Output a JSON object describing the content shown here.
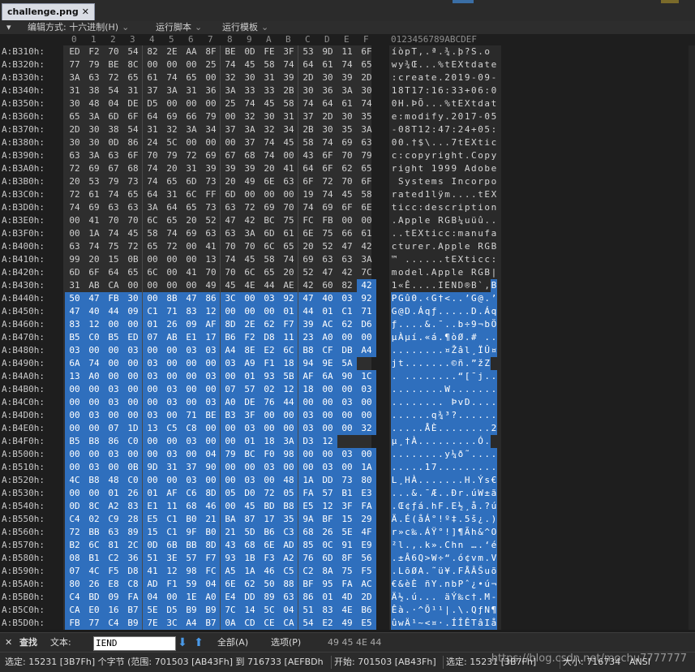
{
  "tab": {
    "title": "challenge.png",
    "close": "✕"
  },
  "toolbar": {
    "menu_glyph": "▾",
    "edit_mode": "编辑方式: 十六进制(H)",
    "run_script": "运行脚本",
    "run_template": "运行模板",
    "chevron": "⌄"
  },
  "hex_columns": [
    "0",
    "1",
    "2",
    "3",
    "4",
    "5",
    "6",
    "7",
    "8",
    "9",
    "A",
    "B",
    "C",
    "D",
    "E",
    "F"
  ],
  "ascii_header": "0123456789ABCDEF",
  "rows": [
    {
      "addr": "A:B310h:",
      "hex": [
        "ED",
        "F2",
        "70",
        "54",
        "82",
        "2E",
        "AA",
        "8F",
        "BE",
        "0D",
        "FE",
        "3F",
        "53",
        "9D",
        "11",
        "6F"
      ],
      "asc": "íòpT‚.ª.¾.þ?S.o"
    },
    {
      "addr": "A:B320h:",
      "hex": [
        "77",
        "79",
        "BE",
        "8C",
        "00",
        "00",
        "00",
        "25",
        "74",
        "45",
        "58",
        "74",
        "64",
        "61",
        "74",
        "65"
      ],
      "asc": "wy¾Œ...%tEXtdate"
    },
    {
      "addr": "A:B330h:",
      "hex": [
        "3A",
        "63",
        "72",
        "65",
        "61",
        "74",
        "65",
        "00",
        "32",
        "30",
        "31",
        "39",
        "2D",
        "30",
        "39",
        "2D"
      ],
      "asc": ":create.2019-09-"
    },
    {
      "addr": "A:B340h:",
      "hex": [
        "31",
        "38",
        "54",
        "31",
        "37",
        "3A",
        "31",
        "36",
        "3A",
        "33",
        "33",
        "2B",
        "30",
        "36",
        "3A",
        "30"
      ],
      "asc": "18T17:16:33+06:0"
    },
    {
      "addr": "A:B350h:",
      "hex": [
        "30",
        "48",
        "04",
        "DE",
        "D5",
        "00",
        "00",
        "00",
        "25",
        "74",
        "45",
        "58",
        "74",
        "64",
        "61",
        "74"
      ],
      "asc": "0H.ÞÕ...%tEXtdat"
    },
    {
      "addr": "A:B360h:",
      "hex": [
        "65",
        "3A",
        "6D",
        "6F",
        "64",
        "69",
        "66",
        "79",
        "00",
        "32",
        "30",
        "31",
        "37",
        "2D",
        "30",
        "35"
      ],
      "asc": "e:modify.2017-05"
    },
    {
      "addr": "A:B370h:",
      "hex": [
        "2D",
        "30",
        "38",
        "54",
        "31",
        "32",
        "3A",
        "34",
        "37",
        "3A",
        "32",
        "34",
        "2B",
        "30",
        "35",
        "3A"
      ],
      "asc": "-08T12:47:24+05:"
    },
    {
      "addr": "A:B380h:",
      "hex": [
        "30",
        "30",
        "0D",
        "86",
        "24",
        "5C",
        "00",
        "00",
        "00",
        "37",
        "74",
        "45",
        "58",
        "74",
        "69",
        "63"
      ],
      "asc": "00.†$\\...7tEXtic"
    },
    {
      "addr": "A:B390h:",
      "hex": [
        "63",
        "3A",
        "63",
        "6F",
        "70",
        "79",
        "72",
        "69",
        "67",
        "68",
        "74",
        "00",
        "43",
        "6F",
        "70",
        "79"
      ],
      "asc": "c:copyright.Copy"
    },
    {
      "addr": "A:B3A0h:",
      "hex": [
        "72",
        "69",
        "67",
        "68",
        "74",
        "20",
        "31",
        "39",
        "39",
        "39",
        "20",
        "41",
        "64",
        "6F",
        "62",
        "65"
      ],
      "asc": "right 1999 Adobe"
    },
    {
      "addr": "A:B3B0h:",
      "hex": [
        "20",
        "53",
        "79",
        "73",
        "74",
        "65",
        "6D",
        "73",
        "20",
        "49",
        "6E",
        "63",
        "6F",
        "72",
        "70",
        "6F"
      ],
      "asc": " Systems Incorpo"
    },
    {
      "addr": "A:B3C0h:",
      "hex": [
        "72",
        "61",
        "74",
        "65",
        "64",
        "31",
        "6C",
        "FF",
        "6D",
        "00",
        "00",
        "00",
        "19",
        "74",
        "45",
        "58"
      ],
      "asc": "rated1lÿm....tEX"
    },
    {
      "addr": "A:B3D0h:",
      "hex": [
        "74",
        "69",
        "63",
        "63",
        "3A",
        "64",
        "65",
        "73",
        "63",
        "72",
        "69",
        "70",
        "74",
        "69",
        "6F",
        "6E"
      ],
      "asc": "ticc:description"
    },
    {
      "addr": "A:B3E0h:",
      "hex": [
        "00",
        "41",
        "70",
        "70",
        "6C",
        "65",
        "20",
        "52",
        "47",
        "42",
        "BC",
        "75",
        "FC",
        "FB",
        "00",
        "00"
      ],
      "asc": ".Apple RGB¼uüû.."
    },
    {
      "addr": "A:B3F0h:",
      "hex": [
        "00",
        "1A",
        "74",
        "45",
        "58",
        "74",
        "69",
        "63",
        "63",
        "3A",
        "6D",
        "61",
        "6E",
        "75",
        "66",
        "61"
      ],
      "asc": "..tEXticc:manufa"
    },
    {
      "addr": "A:B400h:",
      "hex": [
        "63",
        "74",
        "75",
        "72",
        "65",
        "72",
        "00",
        "41",
        "70",
        "70",
        "6C",
        "65",
        "20",
        "52",
        "47",
        "42"
      ],
      "asc": "cturer.Apple RGB"
    },
    {
      "addr": "A:B410h:",
      "hex": [
        "99",
        "20",
        "15",
        "0B",
        "00",
        "00",
        "00",
        "13",
        "74",
        "45",
        "58",
        "74",
        "69",
        "63",
        "63",
        "3A"
      ],
      "asc": "™ ......tEXticc:"
    },
    {
      "addr": "A:B420h:",
      "hex": [
        "6D",
        "6F",
        "64",
        "65",
        "6C",
        "00",
        "41",
        "70",
        "70",
        "6C",
        "65",
        "20",
        "52",
        "47",
        "42",
        "7C"
      ],
      "asc": "model.Apple RGB|"
    },
    {
      "addr": "A:B430h:",
      "hex": [
        "31",
        "AB",
        "CA",
        "00",
        "00",
        "00",
        "00",
        "49",
        "45",
        "4E",
        "44",
        "AE",
        "42",
        "60",
        "82",
        "42"
      ],
      "asc": "1«Ê....IEND®B`‚B"
    },
    {
      "addr": "A:B440h:",
      "hex": [
        "50",
        "47",
        "FB",
        "30",
        "00",
        "8B",
        "47",
        "86",
        "3C",
        "00",
        "03",
        "92",
        "47",
        "40",
        "03",
        "92"
      ],
      "asc": "PGû0.‹G†<..’G@.’"
    },
    {
      "addr": "A:B450h:",
      "hex": [
        "47",
        "40",
        "44",
        "09",
        "C1",
        "71",
        "83",
        "12",
        "00",
        "00",
        "00",
        "01",
        "44",
        "01",
        "C1",
        "71"
      ],
      "asc": "G@D.Áqƒ.....D.Áq"
    },
    {
      "addr": "A:B460h:",
      "hex": [
        "83",
        "12",
        "00",
        "00",
        "01",
        "26",
        "09",
        "AF",
        "8D",
        "2E",
        "62",
        "F7",
        "39",
        "AC",
        "62",
        "D6"
      ],
      "asc": "ƒ....&.¯..b÷9¬bÖ"
    },
    {
      "addr": "A:B470h:",
      "hex": [
        "B5",
        "C0",
        "B5",
        "ED",
        "07",
        "AB",
        "E1",
        "17",
        "B6",
        "F2",
        "D8",
        "11",
        "23",
        "A0",
        "00",
        "00"
      ],
      "asc": "µÀµí.«á.¶òØ.# .."
    },
    {
      "addr": "A:B480h:",
      "hex": [
        "03",
        "00",
        "00",
        "03",
        "00",
        "00",
        "03",
        "03",
        "A4",
        "8E",
        "E2",
        "6C",
        "B8",
        "CF",
        "DB",
        "A4"
      ],
      "asc": "........¤Žâl¸ÏÛ¤"
    },
    {
      "addr": "A:B490h:",
      "hex": [
        "6A",
        "74",
        "00",
        "00",
        "03",
        "00",
        "00",
        "00",
        "03",
        "A9",
        "F1",
        "18",
        "94",
        "9E",
        "5A"
      ],
      "asc": "jt.......©ñ.”žZ"
    },
    {
      "addr": "A:B4A0h:",
      "hex": [
        "13",
        "A0",
        "00",
        "00",
        "03",
        "00",
        "00",
        "03",
        "00",
        "01",
        "93",
        "5B",
        "AF",
        "6A",
        "90",
        "1C"
      ],
      "asc": ". ........“[¯j.."
    },
    {
      "addr": "A:B4B0h:",
      "hex": [
        "00",
        "00",
        "03",
        "00",
        "00",
        "03",
        "00",
        "00",
        "07",
        "57",
        "02",
        "12",
        "18",
        "00",
        "00",
        "03"
      ],
      "asc": "........W......."
    },
    {
      "addr": "A:B4C0h:",
      "hex": [
        "00",
        "00",
        "03",
        "00",
        "00",
        "03",
        "00",
        "03",
        "A0",
        "DE",
        "76",
        "44",
        "00",
        "00",
        "03",
        "00"
      ],
      "asc": "........ ÞvD...."
    },
    {
      "addr": "A:B4D0h:",
      "hex": [
        "00",
        "03",
        "00",
        "00",
        "03",
        "00",
        "71",
        "BE",
        "B3",
        "3F",
        "00",
        "00",
        "03",
        "00",
        "00",
        "00"
      ],
      "asc": "......q¾³?......"
    },
    {
      "addr": "A:B4E0h:",
      "hex": [
        "00",
        "00",
        "07",
        "1D",
        "13",
        "C5",
        "C8",
        "00",
        "00",
        "03",
        "00",
        "00",
        "03",
        "00",
        "00",
        "32"
      ],
      "asc": ".....ÅÈ........2"
    },
    {
      "addr": "A:B4F0h:",
      "hex": [
        "B5",
        "B8",
        "86",
        "C0",
        "00",
        "00",
        "03",
        "00",
        "00",
        "01",
        "18",
        "3A",
        "D3",
        "12"
      ],
      "asc": "µ¸†À.........Ó."
    },
    {
      "addr": "A:B500h:",
      "hex": [
        "00",
        "00",
        "03",
        "00",
        "00",
        "03",
        "00",
        "04",
        "79",
        "BC",
        "F0",
        "98",
        "00",
        "00",
        "03",
        "00"
      ],
      "asc": "........y¼ð˜...."
    },
    {
      "addr": "A:B510h:",
      "hex": [
        "00",
        "03",
        "00",
        "0B",
        "9D",
        "31",
        "37",
        "90",
        "00",
        "00",
        "03",
        "00",
        "00",
        "03",
        "00",
        "1A"
      ],
      "asc": ".....17........."
    },
    {
      "addr": "A:B520h:",
      "hex": [
        "4C",
        "B8",
        "48",
        "C0",
        "00",
        "00",
        "03",
        "00",
        "00",
        "03",
        "00",
        "48",
        "1A",
        "DD",
        "73",
        "80"
      ],
      "asc": "L¸HÀ.......H.Ýs€"
    },
    {
      "addr": "A:B530h:",
      "hex": [
        "00",
        "00",
        "01",
        "26",
        "01",
        "AF",
        "C6",
        "8D",
        "05",
        "D0",
        "72",
        "05",
        "FA",
        "57",
        "B1",
        "E3"
      ],
      "asc": "...&.¯Æ..Ðr.úW±ã"
    },
    {
      "addr": "A:B540h:",
      "hex": [
        "0D",
        "8C",
        "A2",
        "83",
        "E1",
        "11",
        "68",
        "46",
        "00",
        "45",
        "BD",
        "B8",
        "E5",
        "12",
        "3F",
        "FA"
      ],
      "asc": ".Œ¢ƒá.hF.E½¸å.?ú"
    },
    {
      "addr": "A:B550h:",
      "hex": [
        "C4",
        "02",
        "C9",
        "28",
        "E5",
        "C1",
        "B0",
        "21",
        "BA",
        "87",
        "17",
        "35",
        "9A",
        "BF",
        "15",
        "29"
      ],
      "asc": "Ä.É(åÁ°!º‡.5š¿.)"
    },
    {
      "addr": "A:B560h:",
      "hex": [
        "72",
        "BB",
        "63",
        "89",
        "15",
        "C1",
        "9F",
        "B0",
        "21",
        "5D",
        "B6",
        "C3",
        "68",
        "26",
        "5E",
        "4F"
      ],
      "asc": "r»c‰.ÁŸ°!]¶Ãh&^O"
    },
    {
      "addr": "A:B570h:",
      "hex": [
        "B2",
        "6C",
        "81",
        "2C",
        "0D",
        "6B",
        "BB",
        "8D",
        "43",
        "68",
        "6E",
        "AD",
        "85",
        "0C",
        "91",
        "E9"
      ],
      "asc": "²l.,.k».Chn­….‘é"
    },
    {
      "addr": "A:B580h:",
      "hex": [
        "08",
        "B1",
        "C2",
        "36",
        "51",
        "3E",
        "57",
        "F7",
        "93",
        "1B",
        "F3",
        "A2",
        "76",
        "6D",
        "8F",
        "56"
      ],
      "asc": ".±Â6Q>W÷“.ó¢vm.V"
    },
    {
      "addr": "A:B590h:",
      "hex": [
        "07",
        "4C",
        "F5",
        "D8",
        "41",
        "12",
        "98",
        "FC",
        "A5",
        "1A",
        "46",
        "C5",
        "C2",
        "8A",
        "75",
        "F5"
      ],
      "asc": ".LõØA.˜ü¥.FÅÂŠuõ"
    },
    {
      "addr": "A:B5A0h:",
      "hex": [
        "80",
        "26",
        "E8",
        "C8",
        "AD",
        "F1",
        "59",
        "04",
        "6E",
        "62",
        "50",
        "88",
        "BF",
        "95",
        "FA",
        "AC"
      ],
      "asc": "€&èÈ­ñY.nbPˆ¿•ú¬"
    },
    {
      "addr": "A:B5B0h:",
      "hex": [
        "C4",
        "BD",
        "09",
        "FA",
        "04",
        "00",
        "1E",
        "A0",
        "E4",
        "DD",
        "89",
        "63",
        "86",
        "01",
        "4D",
        "2D"
      ],
      "asc": "Ä½.ú... äÝ‰c†.M-"
    },
    {
      "addr": "A:B5C0h:",
      "hex": [
        "CA",
        "E0",
        "16",
        "B7",
        "5E",
        "D5",
        "B9",
        "B9",
        "7C",
        "14",
        "5C",
        "04",
        "51",
        "83",
        "4E",
        "B6"
      ],
      "asc": "Êà.·^Õ¹¹|.\\.QƒN¶"
    },
    {
      "addr": "A:B5D0h:",
      "hex": [
        "FB",
        "77",
        "C4",
        "B9",
        "7E",
        "3C",
        "A4",
        "B7",
        "0A",
        "CD",
        "CE",
        "CA",
        "54",
        "E2",
        "49",
        "E5"
      ],
      "asc": "ûwÄ¹~<¤·.ÍÎÊTâIå"
    }
  ],
  "findbar": {
    "close": "✕",
    "label": "查找",
    "text_label": "文本:",
    "search_value": "IEND",
    "down_arrow": "⬇",
    "up_arrow": "⬆",
    "all_label": "全部(A)",
    "options_label": "选项(P)",
    "result_hex": "49 45 4E 44"
  },
  "statusbar": {
    "selected": "选定: 15231 [3B7Fh] 个字节 (范围: 701503 [AB43Fh] 到 716733 [AEFBDh",
    "start": "开始: 701503 [AB43Fh]",
    "sel2": "选定: 15231 [3B7Fh]",
    "size": "大小: 716734",
    "encoding": "ANSI",
    "watermark": "https://blog.csdn.net/mochu7777777"
  },
  "colors": {
    "selection": "#2f6fbd",
    "background": "#1e1e1e",
    "tab_bg": "#d9dce4"
  }
}
